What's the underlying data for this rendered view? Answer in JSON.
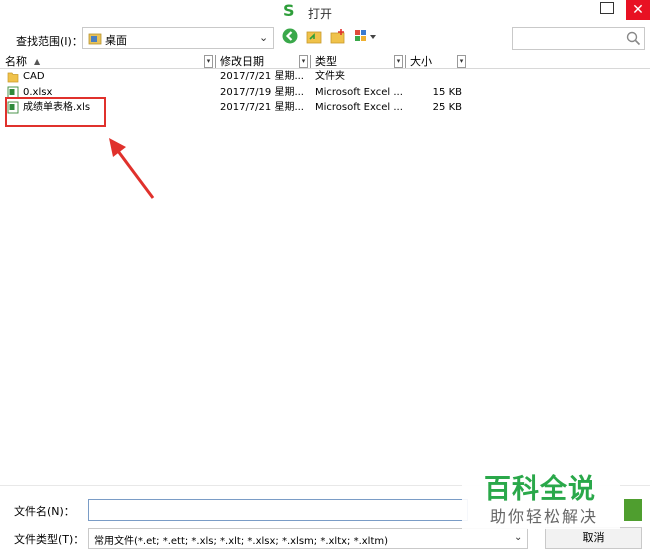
{
  "window": {
    "app_logo": "S",
    "title": "打开",
    "close_glyph": "✕",
    "colors": {
      "close": "#e81123",
      "accent_green": "#2e9e3a",
      "highlight": "#e0312c"
    }
  },
  "toolbar": {
    "lookin_label": "查找范围(I)：",
    "lookin_value": "桌面",
    "lookin_chevron": "⌄",
    "icons": [
      "back-icon",
      "up-folder-icon",
      "new-folder-icon",
      "view-menu-icon"
    ]
  },
  "search": {
    "placeholder": "",
    "icon": "search-icon"
  },
  "list": {
    "columns": [
      {
        "label": "名称",
        "sort": "▲"
      },
      {
        "label": "修改日期"
      },
      {
        "label": "类型"
      },
      {
        "label": "大小"
      }
    ],
    "drop_glyph": "▾",
    "rows": [
      {
        "icon": "folder-icon",
        "name": "CAD",
        "date": "2017/7/21 星期...",
        "type": "文件夹",
        "size": ""
      },
      {
        "icon": "excel-file-icon",
        "name": "0.xlsx",
        "date": "2017/7/19 星期...",
        "type": "Microsoft Excel ...",
        "size": "15 KB"
      },
      {
        "icon": "excel-file-icon",
        "name": "成绩单表格.xls",
        "date": "2017/7/21 星期...",
        "type": "Microsoft Excel ...",
        "size": "25 KB"
      }
    ]
  },
  "bottom": {
    "filename_label": "文件名(N)：",
    "filename_value": "",
    "filetype_label": "文件类型(T)：",
    "filetype_value": "常用文件(*.et; *.ett; *.xls; *.xlt; *.xlsx; *.xlsm; *.xltx; *.xltm)",
    "filetype_chevron": "⌄",
    "cancel_label": "取消"
  },
  "watermark": {
    "main": "百科全说",
    "sub": "助你轻松解决"
  }
}
